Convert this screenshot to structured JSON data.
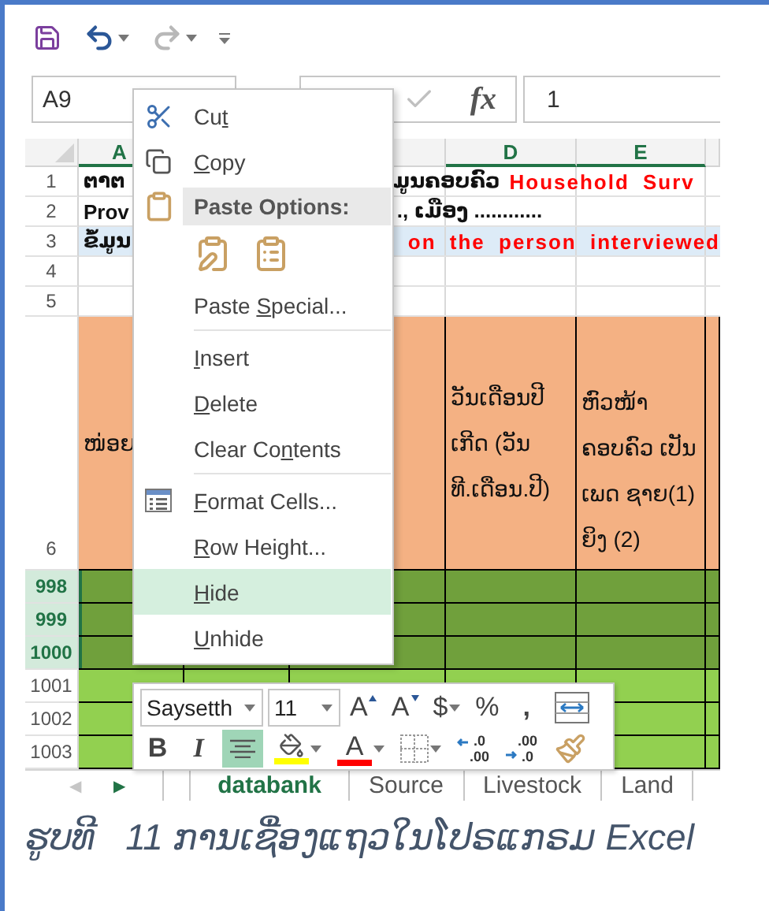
{
  "quick_access": [
    {
      "kind": "save",
      "disabled": false
    },
    {
      "kind": "undo",
      "disabled": false
    },
    {
      "kind": "redo",
      "disabled": true
    },
    {
      "kind": "customize",
      "disabled": false
    }
  ],
  "formula_bar": {
    "name_box": "A9",
    "function_label": "fx",
    "formula": "1"
  },
  "sheet": {
    "columns": [
      {
        "label": "A",
        "selected": true
      },
      {
        "label": "D",
        "selected": true
      },
      {
        "label": "E",
        "selected": true
      }
    ],
    "rows": [
      {
        "header": "1",
        "kind": "text",
        "highlighted": false,
        "left": "ຕາຕ",
        "right": "ມູນຄອບຄົວ",
        "right_accent": "Household Surv"
      },
      {
        "header": "2",
        "kind": "text",
        "highlighted": false,
        "left": "Prov",
        "right": "., ເມືອງ ............"
      },
      {
        "header": "3",
        "kind": "text",
        "highlighted": true,
        "left": "ຂໍ້ມູນ",
        "right_accent": "on the person interviewed"
      },
      {
        "header": "4",
        "kind": "blank"
      },
      {
        "header": "5",
        "kind": "blank"
      },
      {
        "header": "6",
        "kind": "heading",
        "col_a": "ໜ່ອຍ",
        "col_d": "ວັນເດືອນປີ ເກີດ (ວັນ ທີ.ເດືອນ.ປີ)",
        "col_e": "ຫົວໜ້າ ຄອບຄົວ ເປັນເພດ ຊາຍ(1) ຍິງ (2)"
      },
      {
        "header": "998",
        "kind": "data",
        "selected": true
      },
      {
        "header": "999",
        "kind": "data",
        "selected": true
      },
      {
        "header": "1000",
        "kind": "data",
        "selected": true
      },
      {
        "header": "1001",
        "kind": "data",
        "selected": false
      },
      {
        "header": "1002",
        "kind": "data",
        "selected": false
      },
      {
        "header": "1003",
        "kind": "data",
        "selected": false
      }
    ],
    "tab_nav": [
      {
        "text": "◀",
        "disabled": true
      },
      {
        "text": "▶",
        "disabled": false
      }
    ],
    "tabs": [
      {
        "label": "databank",
        "selected": true
      },
      {
        "label": "Source",
        "selected": false
      },
      {
        "label": "Livestock",
        "selected": false
      },
      {
        "label": "Land",
        "selected": false
      }
    ]
  },
  "context_menu": {
    "items": [
      {
        "kind": "cut",
        "before": "Cu",
        "key": "t",
        "selected": false
      },
      {
        "kind": "copy",
        "key": "C",
        "after": "opy",
        "selected": false
      },
      {
        "kind": "header",
        "label": "Paste Options:"
      },
      {
        "kind": "paste_icons"
      },
      {
        "kind": "command",
        "before": "Paste ",
        "key": "S",
        "after": "pecial...",
        "selected": false
      },
      {
        "kind": "separator"
      },
      {
        "kind": "command",
        "key": "I",
        "after": "nsert",
        "selected": false
      },
      {
        "kind": "command",
        "key": "D",
        "after": "elete",
        "selected": false
      },
      {
        "kind": "command",
        "before": "Clear Co",
        "key": "n",
        "after": "tents",
        "selected": false
      },
      {
        "kind": "separator"
      },
      {
        "kind": "format_cells",
        "key": "F",
        "after": "ormat Cells...",
        "selected": false
      },
      {
        "kind": "command",
        "key": "R",
        "after": "ow Height...",
        "selected": false
      },
      {
        "kind": "command",
        "key": "H",
        "after": "ide",
        "selected": true
      },
      {
        "kind": "command",
        "key": "U",
        "after": "nhide",
        "selected": false
      }
    ]
  },
  "mini_toolbar": {
    "font_controls": [
      {
        "kind": "font_field",
        "value": "Saysetth"
      },
      {
        "kind": "size_field",
        "value": "11"
      },
      {
        "kind": "grow",
        "text": "A"
      },
      {
        "kind": "shrink",
        "text": "A"
      },
      {
        "kind": "currency",
        "text": "$"
      },
      {
        "kind": "percent",
        "text": "%"
      },
      {
        "kind": "comma",
        "text": ","
      },
      {
        "kind": "merge"
      }
    ],
    "format_controls": [
      {
        "kind": "bold",
        "text": "B",
        "selected": false
      },
      {
        "kind": "italic",
        "text": "I",
        "selected": false
      },
      {
        "kind": "align_center",
        "selected": true
      },
      {
        "kind": "fill_color",
        "color": "#ffff00"
      },
      {
        "kind": "font_color",
        "text": "A",
        "color": "#ff0000"
      },
      {
        "kind": "borders"
      },
      {
        "kind": "increase_decimal",
        "top": ".0",
        "bottom": ".00"
      },
      {
        "kind": "decrease_decimal",
        "top": ".00",
        "bottom": ".0"
      },
      {
        "kind": "format_painter"
      }
    ]
  },
  "caption": "ຮູບທີ   11 ການເຊື່ອງແຖວໃນໂປຣແກຣມ Excel"
}
